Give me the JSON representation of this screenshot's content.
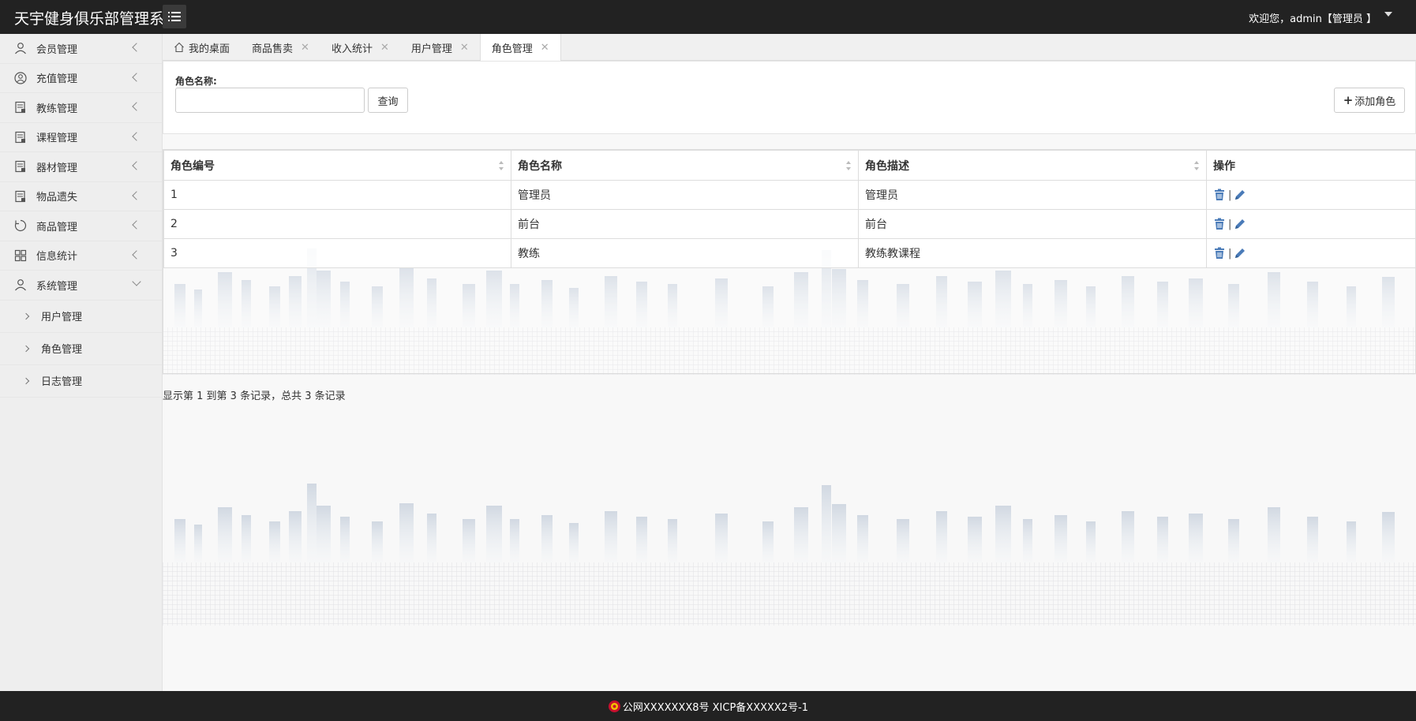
{
  "header": {
    "brand": "天宇健身俱乐部管理系统",
    "welcome": "欢迎您，admin【管理员 】"
  },
  "sidebar": {
    "items": [
      {
        "label": "会员管理",
        "icon": "user-icon"
      },
      {
        "label": "充值管理",
        "icon": "user-circle-icon"
      },
      {
        "label": "教练管理",
        "icon": "document-icon"
      },
      {
        "label": "课程管理",
        "icon": "document-icon"
      },
      {
        "label": "器材管理",
        "icon": "document-icon"
      },
      {
        "label": "物品遗失",
        "icon": "document-icon"
      },
      {
        "label": "商品管理",
        "icon": "refresh-icon"
      },
      {
        "label": "信息统计",
        "icon": "grid-icon"
      },
      {
        "label": "系统管理",
        "icon": "user-icon"
      }
    ],
    "sub_items": [
      "用户管理",
      "角色管理",
      "日志管理"
    ]
  },
  "tabs": [
    {
      "label": "我的桌面",
      "closable": false
    },
    {
      "label": "商品售卖",
      "closable": true
    },
    {
      "label": "收入统计",
      "closable": true
    },
    {
      "label": "用户管理",
      "closable": true
    },
    {
      "label": "角色管理",
      "closable": true,
      "active": true
    }
  ],
  "search": {
    "label": "角色名称:",
    "value": "",
    "query_button": "查询",
    "add_button": "添加角色"
  },
  "table": {
    "columns": [
      "角色编号",
      "角色名称",
      "角色描述",
      "操作"
    ],
    "rows": [
      [
        "1",
        "管理员",
        "管理员"
      ],
      [
        "2",
        "前台",
        "前台"
      ],
      [
        "3",
        "教练",
        "教练教课程"
      ]
    ]
  },
  "pager": {
    "info": "显示第 1 到第 3 条记录，总共 3 条记录"
  },
  "footer": {
    "text": "公网XXXXXXX8号 XICP备XXXXX2号-1"
  },
  "colors": {
    "header_bg": "#222222",
    "sidebar_bg": "#eeeeee",
    "icon_blue": "#4a7bb8"
  }
}
